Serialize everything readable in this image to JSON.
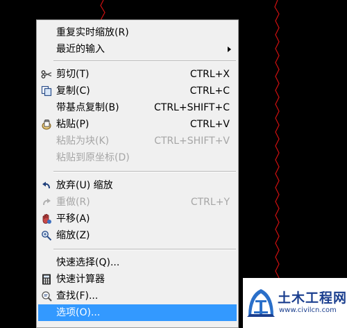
{
  "menu": {
    "items": {
      "repeat_zoom": "重复实时缩放(R)",
      "recent_input": "最近的输入",
      "cut": "剪切(T)",
      "cut_shortcut": "CTRL+X",
      "copy": "复制(C)",
      "copy_shortcut": "CTRL+C",
      "copy_base": "带基点复制(B)",
      "copy_base_shortcut": "CTRL+SHIFT+C",
      "paste": "粘贴(P)",
      "paste_shortcut": "CTRL+V",
      "paste_block": "粘贴为块(K)",
      "paste_block_shortcut": "CTRL+SHIFT+V",
      "paste_orig": "粘贴到原坐标(D)",
      "undo": "放弃(U) 缩放",
      "redo": "重做(R)",
      "redo_shortcut": "CTRL+Y",
      "pan": "平移(A)",
      "zoom": "缩放(Z)",
      "quick_select": "快速选择(Q)...",
      "quick_calc": "快速计算器",
      "find": "查找(F)...",
      "options": "选项(O)..."
    },
    "disabled_items": [
      "paste_block",
      "paste_orig",
      "redo"
    ],
    "selected_item": "options"
  },
  "icons": {
    "cut": "scissors-icon",
    "copy": "copy-icon",
    "paste": "paste-icon",
    "undo": "undo-arrow-icon",
    "redo": "redo-arrow-icon",
    "pan": "pan-hand-icon",
    "zoom": "zoom-icon",
    "quick_calc": "calculator-icon",
    "find": "find-icon",
    "recent_input": "submenu-arrow-icon"
  },
  "watermark": {
    "title": "土木工程网",
    "url": "www.civilcn.com"
  },
  "colors": {
    "background": "#000000",
    "menu_bg": "#f0f0f0",
    "selection": "#3399ff",
    "disabled_text": "#a6a6a6",
    "drawing_line": "#d01010",
    "watermark_blue": "#1b3f8f"
  }
}
